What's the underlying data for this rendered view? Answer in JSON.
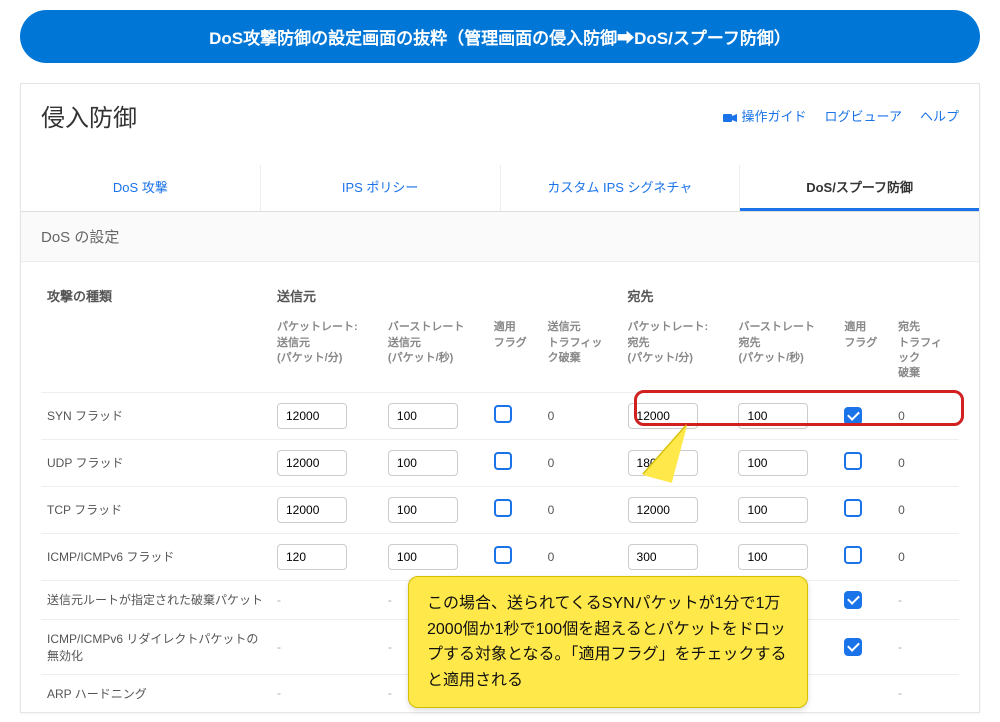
{
  "banner": "DoS攻撃防御の設定画面の抜粋（管理画面の侵入防御➡DoS/スプーフ防御）",
  "page_title": "侵入防御",
  "header_links": {
    "guide": "操作ガイド",
    "logviewer": "ログビューア",
    "help": "ヘルプ"
  },
  "tabs": [
    "DoS 攻撃",
    "IPS ポリシー",
    "カスタム IPS シグネチャ",
    "DoS/スプーフ防御"
  ],
  "active_tab": 3,
  "section_title": "DoS の設定",
  "columns": {
    "attack": "攻撃の種類",
    "source_group": "送信元",
    "dest_group": "宛先",
    "src_rate": "パケットレート:\n送信元\n(パケット/分)",
    "src_burst": "バーストレート\n送信元\n(パケット/秒)",
    "src_flag": "適用\nフラグ",
    "src_drop": "送信元\nトラフィッ\nク破棄",
    "dst_rate": "パケットレート:\n宛先\n(パケット/分)",
    "dst_burst": "バーストレート\n宛先\n(パケット/秒)",
    "dst_flag": "適用\nフラグ",
    "dst_drop": "宛先\nトラフィ\nック\n破棄"
  },
  "rows": [
    {
      "name": "SYN フラッド",
      "src_rate": "12000",
      "src_burst": "100",
      "src_flag": false,
      "src_drop": "0",
      "dst_rate": "12000",
      "dst_burst": "100",
      "dst_flag": true,
      "dst_drop": "0"
    },
    {
      "name": "UDP フラッド",
      "src_rate": "12000",
      "src_burst": "100",
      "src_flag": false,
      "src_drop": "0",
      "dst_rate": "18000",
      "dst_burst": "100",
      "dst_flag": false,
      "dst_drop": "0"
    },
    {
      "name": "TCP フラッド",
      "src_rate": "12000",
      "src_burst": "100",
      "src_flag": false,
      "src_drop": "0",
      "dst_rate": "12000",
      "dst_burst": "100",
      "dst_flag": false,
      "dst_drop": "0"
    },
    {
      "name": "ICMP/ICMPv6 フラッド",
      "src_rate": "120",
      "src_burst": "100",
      "src_flag": false,
      "src_drop": "0",
      "dst_rate": "300",
      "dst_burst": "100",
      "dst_flag": false,
      "dst_drop": "0"
    },
    {
      "name": "送信元ルートが指定された破棄パケット",
      "src_rate": "-",
      "src_burst": "-",
      "src_flag": null,
      "src_drop": "-",
      "dst_rate": "-",
      "dst_burst": "-",
      "dst_flag": true,
      "dst_drop": "-"
    },
    {
      "name": "ICMP/ICMPv6 リダイレクトパケットの無効化",
      "src_rate": "-",
      "src_burst": "-",
      "src_flag": null,
      "src_drop": "-",
      "dst_rate": "-",
      "dst_burst": "-",
      "dst_flag": true,
      "dst_drop": "-"
    },
    {
      "name": "ARP ハードニング",
      "src_rate": "-",
      "src_burst": "-",
      "src_flag": null,
      "src_drop": "-",
      "dst_rate": "-",
      "dst_burst": "-",
      "dst_flag": null,
      "dst_drop": "-"
    }
  ],
  "callout_text": "この場合、送られてくるSYNパケットが1分で1万2000個か1秒で100個を超えるとパケットをドロップする対象となる。「適用フラグ」をチェックすると適用される"
}
